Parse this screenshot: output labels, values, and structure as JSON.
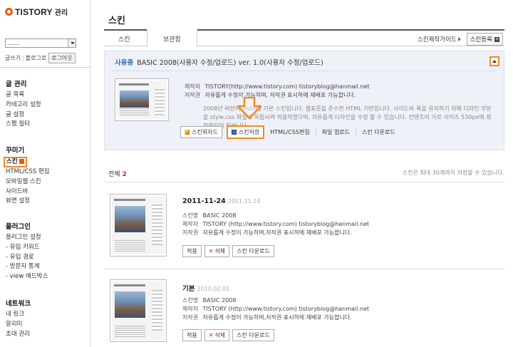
{
  "brand": {
    "name": "TISTORY",
    "suffix": "관리"
  },
  "sidebar": {
    "blog_select": ".......",
    "links": [
      "글쓰기",
      "블로그로"
    ],
    "logout": "로그아웃",
    "groups": [
      {
        "title": "글 관리",
        "items": [
          "글 목록",
          "카테고리 설정",
          "글 설정",
          "스팸 필터"
        ]
      },
      {
        "title": "꾸미기",
        "items": [
          "스킨",
          "HTML/CSS 편집",
          "모바일웹 스킨",
          "사이드바",
          "화면 설정"
        ]
      },
      {
        "title": "플러그인",
        "items": [
          "플러그인 설정",
          "- 유입 키워드",
          "- 유입 경로",
          "- 방문자 통계",
          "- view 애드박스"
        ]
      },
      {
        "title": "네트워크",
        "items": [
          "내 링크",
          "알리미",
          "초대 관리"
        ]
      }
    ]
  },
  "main": {
    "title": "스킨",
    "tabs": [
      "스킨",
      "보관함"
    ],
    "guide_link": "스킨제작가이드",
    "register_btn": "스킨등록",
    "current": {
      "status": "사용중",
      "name": "BASIC 2008(사용자 수정/업로드) ver. 1.0(사용자 수정/업로드)",
      "author_label": "제작자",
      "author": "TISTORY(http://www.tistory.com) tistoryblog@hanmail.net",
      "copyright_label": "저작권",
      "copyright": "자유롭게 수정이 가능하며, 저작권 표시하에 재배포 가능합니다.",
      "description": "2008년 버전의 Tistory 기본 스킨입니다. 웹표준을 준수한 HTML 기반입니다. 사이드바 폭을 유지하기 위해 디자인 부분을 style.css 파일에 독립시켜 적용하였으며, 자유롭게 디자인을 수정 할 수 있습니다. 컨텐츠의 가로 사이즈 530px에 최적화되어 있습니다.",
      "btn_wizard": "스킨위자드",
      "btn_save": "스킨저장",
      "link_html": "HTML/CSS편집",
      "link_upload": "파일 업로드",
      "link_download": "스킨 다운로드"
    },
    "count_label": "전체",
    "count": "2",
    "count_note": "스킨은 최대 30개까지 저장할 수 있습니다.",
    "items": [
      {
        "title": "2011-11-24",
        "date": "2011.11.24",
        "skin_label": "스킨명",
        "skin": "BASIC 2008",
        "author_label": "제작자",
        "author": "TISTORY (http://www.tistory.com) tistoryblog@hanmail.net",
        "copyright_label": "저작권",
        "copyright": "자유롭게 수정이 가능하며,저작권 표시하에 재배포 가능합니다.",
        "apply": "적용",
        "delete": "삭제",
        "download": "스킨 다운로드"
      },
      {
        "title": "기본",
        "date": "2010.02.01",
        "skin_label": "스킨명",
        "skin": "BASIC 2008",
        "author_label": "제작자",
        "author": "TISTORY (http://www.tistory.com) tistoryblog@hanmail.net",
        "copyright_label": "저작권",
        "copyright": "자유롭게 수정이 가능하며,저작권 표시하에 재배포 가능합니다.",
        "apply": "적용",
        "delete": "삭제",
        "download": "스킨 다운로드"
      }
    ]
  },
  "colors": {
    "highlight": "#f08a24",
    "accent": "#e8590c",
    "inuse": "#3b6fb6",
    "panel": "#eef1f8"
  }
}
